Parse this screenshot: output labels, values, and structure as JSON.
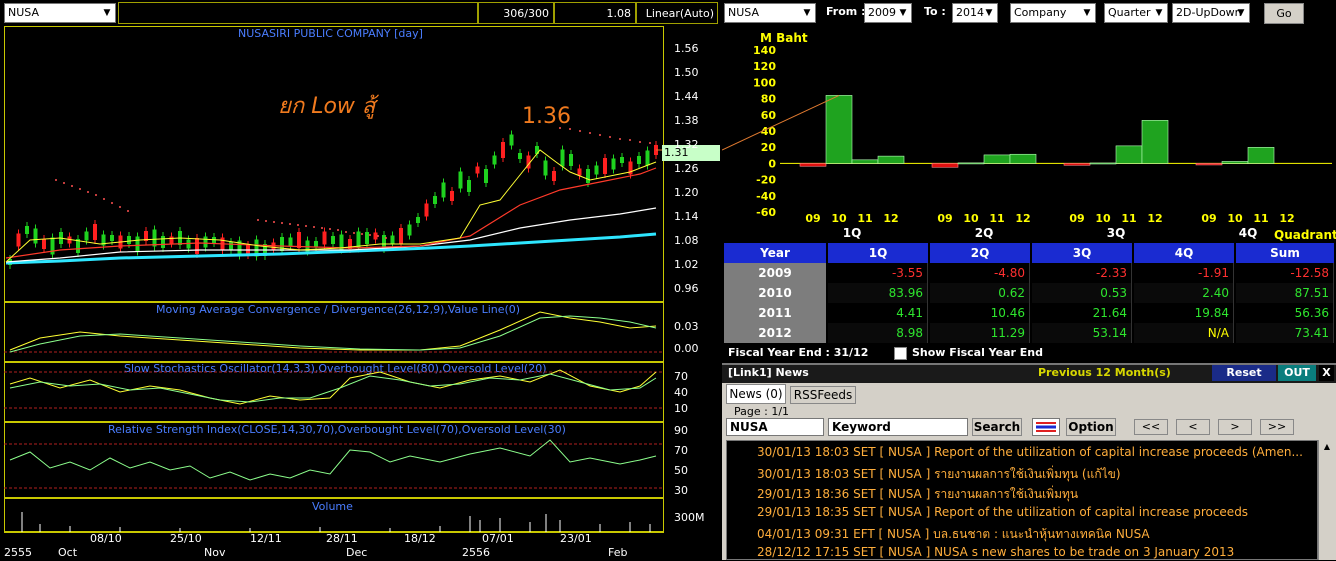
{
  "left_toolbar": {
    "symbol": "NUSA",
    "count": "306/300",
    "zoom": "1.08",
    "scale": "Linear(Auto)"
  },
  "price_panel": {
    "title": "NUSASIRI PUBLIC COMPANY [day]",
    "annotation_thai": "ยก Low สู้",
    "annotation_high": "1.36",
    "last_price": "1.31",
    "y_ticks": [
      "1.56",
      "1.50",
      "1.44",
      "1.38",
      "1.32",
      "1.26",
      "1.20",
      "1.14",
      "1.08",
      "1.02",
      "0.96"
    ]
  },
  "macd_panel": {
    "title": "Moving Average Convergence / Divergence(26,12,9),Value Line(0)",
    "y_ticks": [
      "0.03",
      "0.00"
    ]
  },
  "stoch_panel": {
    "title": "Slow Stochastics Oscillator(14,3,3),Overbought Level(80),Oversold Level(20)",
    "y_ticks": [
      "70",
      "40",
      "10"
    ]
  },
  "rsi_panel": {
    "title": "Relative Strength Index(CLOSE,14,30,70),Overbought Level(70),Oversold Level(30)",
    "y_ticks": [
      "90",
      "70",
      "50",
      "30"
    ]
  },
  "volume_panel": {
    "title": "Volume",
    "y_ticks": [
      "300M"
    ]
  },
  "date_axis": {
    "upper": [
      "08/10",
      "25/10",
      "12/11",
      "28/11",
      "18/12",
      "07/01",
      "23/01"
    ],
    "lower": [
      "2555",
      "Oct",
      "Nov",
      "Dec",
      "2556",
      "Feb"
    ]
  },
  "right_toolbar": {
    "symbol": "NUSA",
    "from_label": "From :",
    "from_value": "2009",
    "to_label": "To :",
    "to_value": "2014",
    "type": "Company",
    "period": "Quarter",
    "view": "2D-UpDown",
    "go": "Go"
  },
  "chart_data": {
    "type": "bar",
    "ylabel": "M Baht",
    "ylim": [
      -60,
      140
    ],
    "y_ticks": [
      "140",
      "120",
      "100",
      "80",
      "60",
      "40",
      "20",
      "0",
      "-20",
      "-40",
      "-60"
    ],
    "quarters": [
      "1Q",
      "2Q",
      "3Q",
      "4Q"
    ],
    "quadrant_label": "Quadrant",
    "year_ticks": [
      "09",
      "10",
      "11",
      "12"
    ],
    "groups": [
      {
        "quarter": "1Q",
        "values": [
          -3.55,
          83.96,
          4.41,
          8.98
        ]
      },
      {
        "quarter": "2Q",
        "values": [
          -4.8,
          0.62,
          10.46,
          11.29
        ]
      },
      {
        "quarter": "3Q",
        "values": [
          -2.33,
          0.53,
          21.64,
          53.14
        ]
      },
      {
        "quarter": "4Q",
        "values": [
          -1.91,
          2.4,
          19.84,
          null
        ]
      }
    ],
    "colors": {
      "positive": "#1fa31f",
      "negative": "#e01010"
    }
  },
  "table": {
    "headers": [
      "Year",
      "1Q",
      "2Q",
      "3Q",
      "4Q",
      "Sum"
    ],
    "rows": [
      {
        "year": "2009",
        "cells": [
          "-3.55",
          "-4.80",
          "-2.33",
          "-1.91",
          "-12.58"
        ]
      },
      {
        "year": "2010",
        "cells": [
          "83.96",
          "0.62",
          "0.53",
          "2.40",
          "87.51"
        ]
      },
      {
        "year": "2011",
        "cells": [
          "4.41",
          "10.46",
          "21.64",
          "19.84",
          "56.36"
        ]
      },
      {
        "year": "2012",
        "cells": [
          "8.98",
          "11.29",
          "53.14",
          "N/A",
          "73.41"
        ]
      }
    ],
    "fiscal_label": "Fiscal  Year  End  :  31/12",
    "show_fiscal": "Show Fiscal Year End"
  },
  "news": {
    "header": "[Link1] News",
    "prev": "Previous 12 Month(s)",
    "reset": "Reset",
    "out": "OUT",
    "close": "X",
    "tabs": [
      "News (0)",
      "RSSFeeds"
    ],
    "page": "Page : 1/1",
    "symbol": "NUSA",
    "keyword": "Keyword",
    "search": "Search",
    "option": "Option",
    "nav": [
      "<<",
      "<",
      ">",
      ">>"
    ],
    "items": [
      "30/01/13 18:03  SET  [ NUSA ]  Report of the utilization of capital increase proceeds (Amen...",
      "30/01/13 18:03  SET  [ NUSA ]  รายงานผลการใช้เงินเพิ่มทุน (แก้ไข)",
      "29/01/13 18:36  SET  [ NUSA ]  รายงานผลการใช้เงินเพิ่มทุน",
      "29/01/13 18:35  SET  [ NUSA ]  Report of the utilization of capital increase proceeds",
      "04/01/13 09:31  EFT  [ NUSA ]  บล.ธนชาต : แนะนำหุ้นทางเทคนิค NUSA",
      "28/12/12 17:15  SET  [ NUSA ]  NUSA s new shares to be trade on 3 January 2013"
    ]
  }
}
